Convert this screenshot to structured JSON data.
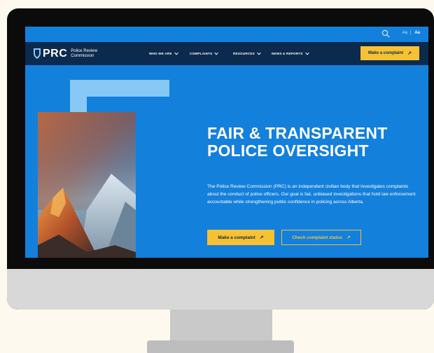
{
  "utility": {
    "search_icon": "search-icon",
    "text_size_small": "Aa",
    "separator": "|",
    "text_size_large": "Aa"
  },
  "brand": {
    "logo_text": "PRC",
    "logo_subtitle_line1": "Police Review",
    "logo_subtitle_line2": "Commission",
    "logo_icon": "shield-icon"
  },
  "nav": {
    "items": [
      {
        "label": "WHO WE ARE"
      },
      {
        "label": "COMPLAINTS"
      },
      {
        "label": "RESOURCES"
      },
      {
        "label": "NEWS & REPORTS"
      }
    ],
    "cta_label": "Make a complaint",
    "cta_icon": "arrow-up-right-icon"
  },
  "hero": {
    "title_line1": "FAIR & TRANSPARENT",
    "title_line2": "POLICE OVERSIGHT",
    "body": "The Police Review Commission (PRC) is an independent civilian body that investigates complaints about the conduct of police officers. Our goal is fair, unbiased investigations that hold law enforcement accountable while strengthening public confidence in policing across Alberta.",
    "primary_cta": "Make a complaint",
    "secondary_cta": "Check complaint status",
    "image": "mountain-photo"
  },
  "colors": {
    "primary_blue": "#1380dc",
    "navy": "#0c2a4e",
    "accent_yellow": "#f6c133",
    "light_blue_panel": "#88c8f6",
    "background": "#fdf9ee"
  }
}
